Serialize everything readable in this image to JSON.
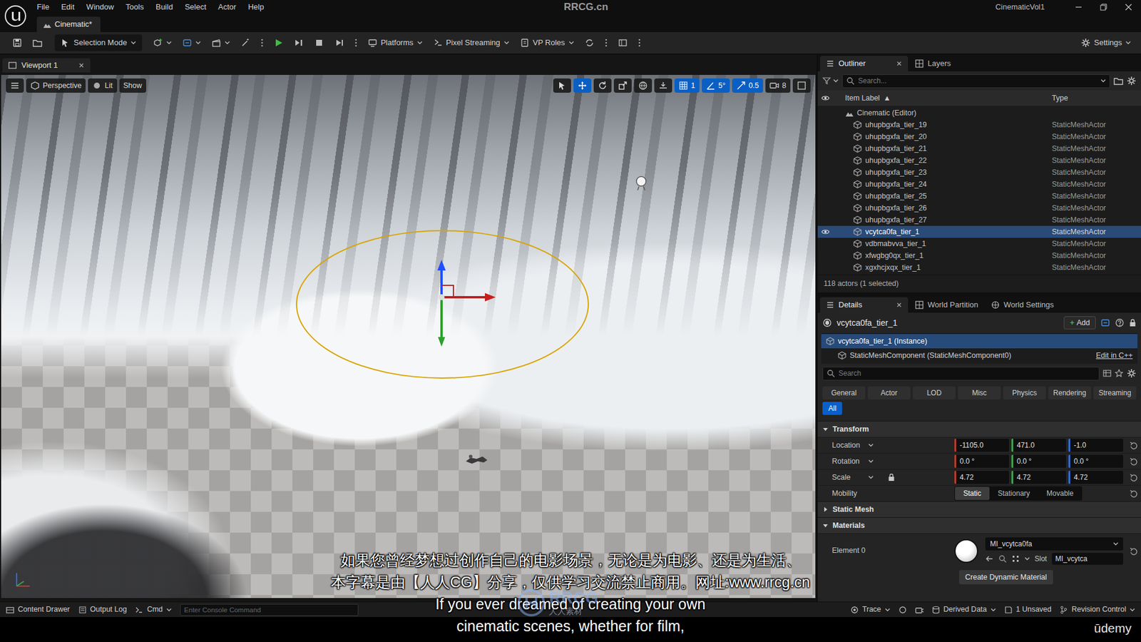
{
  "window": {
    "title": "RRCG.cn",
    "project": "CinematicVol1"
  },
  "menu": [
    "File",
    "Edit",
    "Window",
    "Tools",
    "Build",
    "Select",
    "Actor",
    "Help"
  ],
  "document_tab": {
    "label": "Cinematic*"
  },
  "toolbar": {
    "selection_mode": "Selection Mode",
    "platforms": "Platforms",
    "pixel_streaming": "Pixel Streaming",
    "vp_roles": "VP Roles",
    "settings": "Settings"
  },
  "viewport": {
    "tab": "Viewport 1",
    "view_mode": "Perspective",
    "lighting": "Lit",
    "show": "Show",
    "tools": [
      {
        "kind": "select",
        "selected": false
      },
      {
        "kind": "translate",
        "selected": true
      },
      {
        "kind": "rotate",
        "selected": false
      },
      {
        "kind": "scale",
        "selected": false
      }
    ],
    "snaps": [
      {
        "kind": "grid",
        "value": "1",
        "on": true
      },
      {
        "kind": "rotation",
        "value": "5°",
        "on": true
      },
      {
        "kind": "scale",
        "value": "0.5",
        "on": true
      }
    ],
    "camera_speed": "8"
  },
  "overlay": {
    "subtitles_zh": [
      "如果您曾经梦想过创作自己的电影场景，无论是为电影、还是为生活、",
      "本字幕是由【人人CG】分享，仅供学习交流禁止商用。网址:www.rrcg.cn"
    ],
    "subtitles_en": [
      "If you ever dreamed of creating your own",
      "cinematic scenes, whether for film,"
    ],
    "logo": "RRCG",
    "logo_sub": "人人素材",
    "brand": "ūdemy"
  },
  "outliner": {
    "tabs": [
      {
        "label": "Outliner",
        "selected": true
      },
      {
        "label": "Layers",
        "selected": false
      }
    ],
    "search": "Search...",
    "columns": [
      "Item Label",
      "Type"
    ],
    "sort_indicator": "▲",
    "root": "Cinematic (Editor)",
    "rows": [
      {
        "label": "uhupbgxfa_tier_19",
        "type": "StaticMeshActor",
        "selected": false
      },
      {
        "label": "uhupbgxfa_tier_20",
        "type": "StaticMeshActor",
        "selected": false
      },
      {
        "label": "uhupbgxfa_tier_21",
        "type": "StaticMeshActor",
        "selected": false
      },
      {
        "label": "uhupbgxfa_tier_22",
        "type": "StaticMeshActor",
        "selected": false
      },
      {
        "label": "uhupbgxfa_tier_23",
        "type": "StaticMeshActor",
        "selected": false
      },
      {
        "label": "uhupbgxfa_tier_24",
        "type": "StaticMeshActor",
        "selected": false
      },
      {
        "label": "uhupbgxfa_tier_25",
        "type": "StaticMeshActor",
        "selected": false
      },
      {
        "label": "uhupbgxfa_tier_26",
        "type": "StaticMeshActor",
        "selected": false
      },
      {
        "label": "uhupbgxfa_tier_27",
        "type": "StaticMeshActor",
        "selected": false
      },
      {
        "label": "vcytca0fa_tier_1",
        "type": "StaticMeshActor",
        "selected": true
      },
      {
        "label": "vdbmabvva_tier_1",
        "type": "StaticMeshActor",
        "selected": false
      },
      {
        "label": "xfwgbg0qx_tier_1",
        "type": "StaticMeshActor",
        "selected": false
      },
      {
        "label": "xgxhcjxqx_tier_1",
        "type": "StaticMeshActor",
        "selected": false
      }
    ],
    "count": "118 actors (1 selected)"
  },
  "details": {
    "tabs": [
      {
        "label": "Details",
        "selected": true
      },
      {
        "label": "World Partition",
        "selected": false
      },
      {
        "label": "World Settings",
        "selected": false
      }
    ],
    "actor": "vcytca0fa_tier_1",
    "add_icon": "+",
    "add": "Add",
    "components": [
      {
        "label": "vcytca0fa_tier_1 (Instance)",
        "selected": true
      },
      {
        "label": "StaticMeshComponent (StaticMeshComponent0)",
        "selected": false
      }
    ],
    "edit_cpp": "Edit in C++",
    "search": "Search",
    "filters": [
      {
        "label": "General",
        "selected": false
      },
      {
        "label": "Actor",
        "selected": false
      },
      {
        "label": "LOD",
        "selected": false
      },
      {
        "label": "Misc",
        "selected": false
      },
      {
        "label": "Physics",
        "selected": false
      },
      {
        "label": "Rendering",
        "selected": false
      },
      {
        "label": "Streaming",
        "selected": false
      },
      {
        "label": "All",
        "selected": true
      }
    ],
    "sections": [
      {
        "title": "Transform",
        "expanded": true,
        "properties": [
          {
            "kind": "vector",
            "label": "Location",
            "values": [
              "-1105.0",
              "471.0",
              "-1.0"
            ]
          },
          {
            "kind": "vector",
            "label": "Rotation",
            "values": [
              "0.0 °",
              "0.0 °",
              "0.0 °"
            ]
          },
          {
            "kind": "vector",
            "label": "Scale",
            "values": [
              "4.72",
              "4.72",
              "4.72"
            ],
            "locked": true
          },
          {
            "kind": "choice",
            "label": "Mobility",
            "options": [
              {
                "label": "Static",
                "selected": true
              },
              {
                "label": "Stationary",
                "selected": false
              },
              {
                "label": "Movable",
                "selected": false
              }
            ]
          }
        ]
      },
      {
        "title": "Static Mesh",
        "expanded": false,
        "properties": []
      },
      {
        "title": "Materials",
        "expanded": true,
        "properties": [
          {
            "kind": "material",
            "label": "Element 0",
            "material": "MI_vcytca0fa",
            "slot_label": "Slot",
            "slot": "MI_vcytca",
            "button": "Create Dynamic Material"
          }
        ]
      }
    ]
  },
  "status_bar": {
    "left": [
      "Content Drawer",
      "Output Log"
    ],
    "cmd": "Cmd",
    "console_placeholder": "Enter Console Command",
    "right": [
      "Trace",
      "Derived Data",
      "1 Unsaved",
      "Revision Control"
    ]
  }
}
